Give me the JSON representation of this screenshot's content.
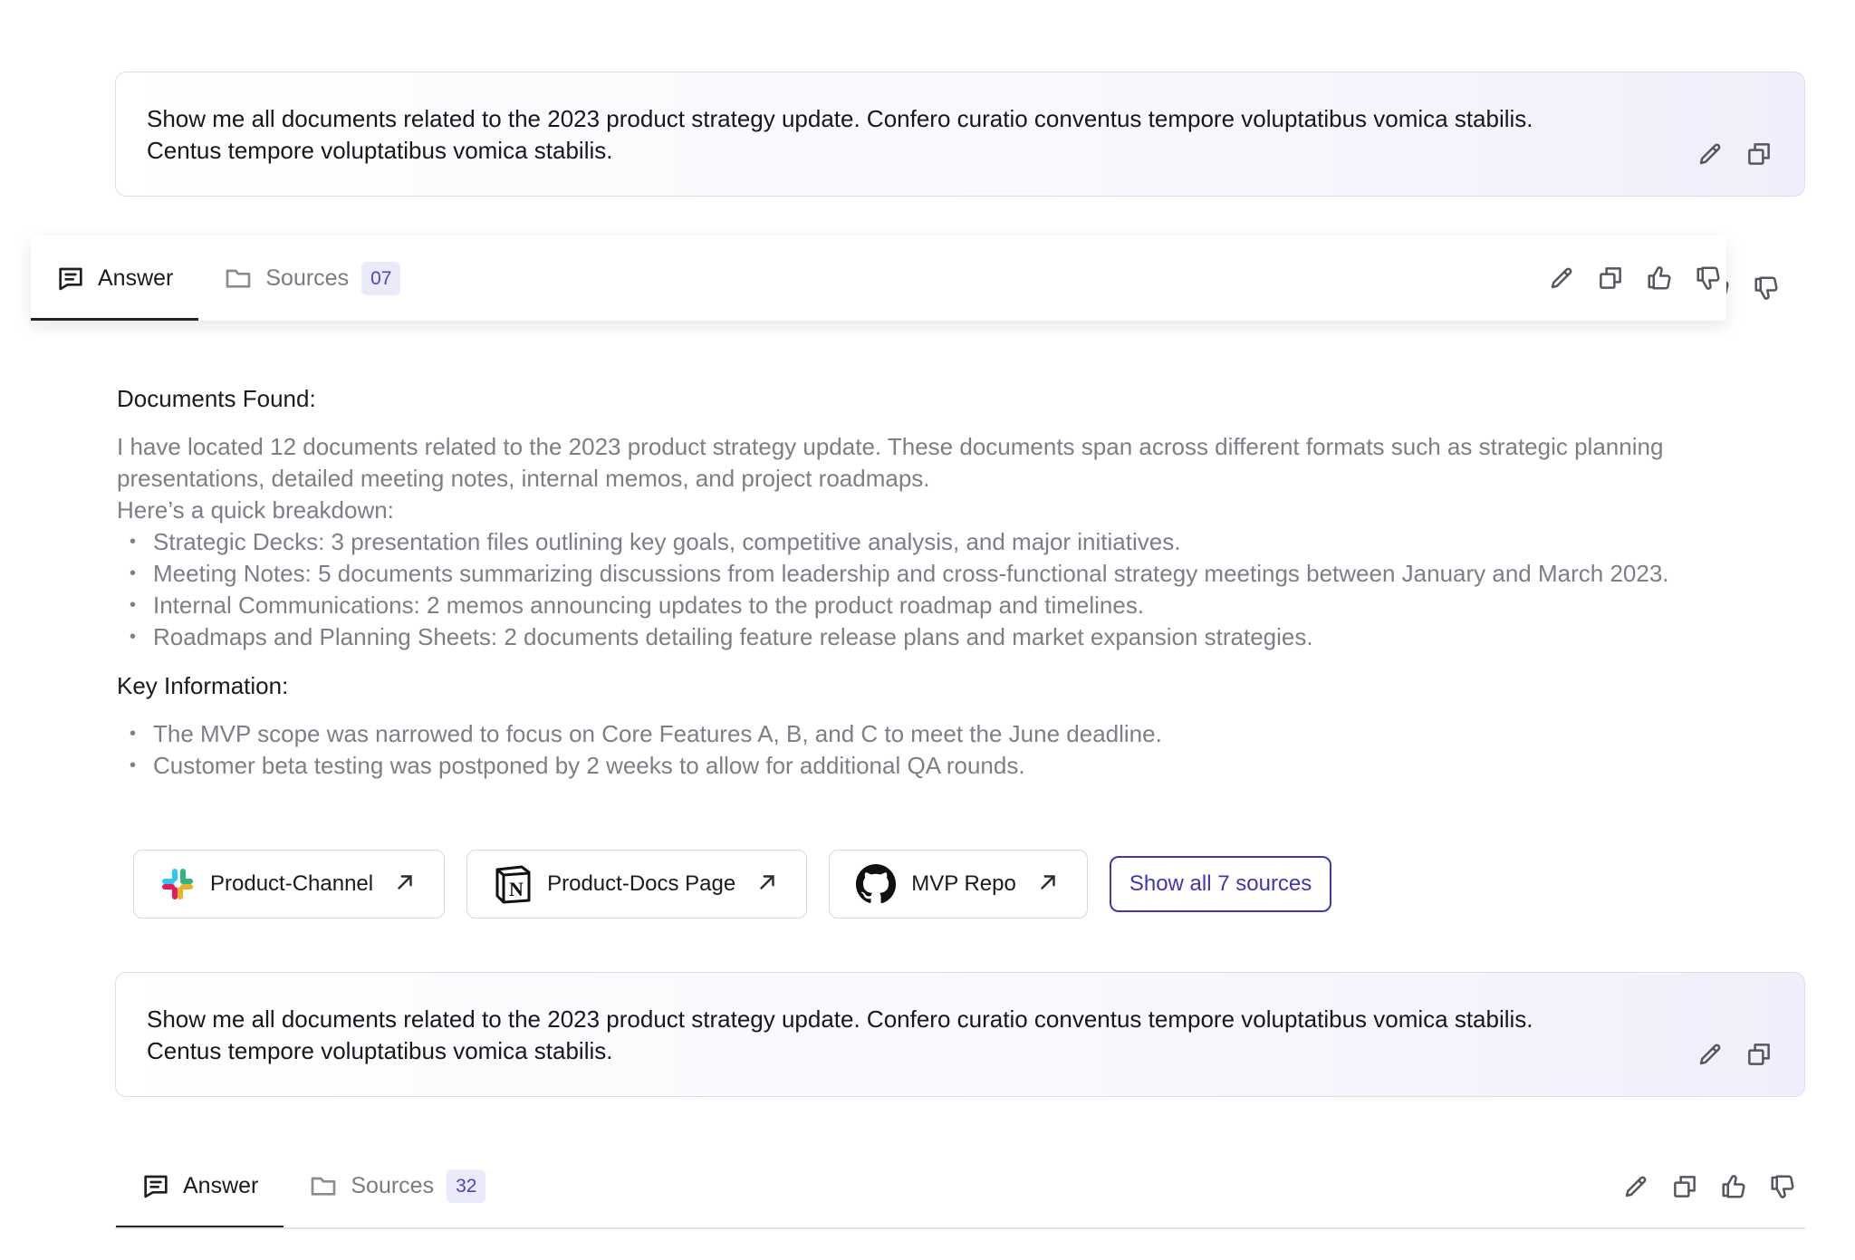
{
  "query1": {
    "line1": "Show me all documents related to the 2023 product strategy update. Confero curatio conventus tempore voluptatibus vomica stabilis.",
    "line2": "Centus tempore voluptatibus vomica stabilis."
  },
  "tabs1": {
    "answer_label": "Answer",
    "sources_label": "Sources",
    "sources_count": "07"
  },
  "answer": {
    "heading1": "Documents Found:",
    "intro": "I have located 12 documents related to the 2023 product strategy update. These documents span across different formats such as strategic planning presentations, detailed meeting notes, internal memos, and project roadmaps.",
    "breakdown_label": "Here’s a quick breakdown:",
    "breakdown": [
      "Strategic Decks: 3 presentation files outlining key goals, competitive analysis, and major initiatives.",
      "Meeting Notes: 5 documents summarizing discussions from leadership and cross-functional strategy meetings between January and March 2023.",
      "Internal Communications: 2 memos announcing updates to the product roadmap and timelines.",
      "Roadmaps and Planning Sheets: 2 documents detailing feature release plans and market expansion strategies."
    ],
    "heading2": "Key Information:",
    "key_points": [
      "The MVP scope was narrowed to focus on Core Features A, B, and C to meet the June deadline.",
      "Customer beta testing was postponed by 2 weeks to allow for additional QA rounds."
    ]
  },
  "sources": {
    "chips": [
      {
        "label": "Product-Channel",
        "icon": "slack-icon"
      },
      {
        "label": "Product-Docs Page",
        "icon": "notion-icon"
      },
      {
        "label": "MVP Repo",
        "icon": "github-icon"
      }
    ],
    "show_all_label": "Show all 7 sources"
  },
  "query2": {
    "line1": "Show me all documents related to the 2023 product strategy update. Confero curatio conventus tempore voluptatibus vomica stabilis.",
    "line2": "Centus tempore voluptatibus vomica stabilis."
  },
  "tabs2": {
    "answer_label": "Answer",
    "sources_label": "Sources",
    "sources_count": "32"
  },
  "colors": {
    "accent": "#3f37b0",
    "badge_bg": "#ebeafb",
    "muted_text": "#7d7e86"
  }
}
